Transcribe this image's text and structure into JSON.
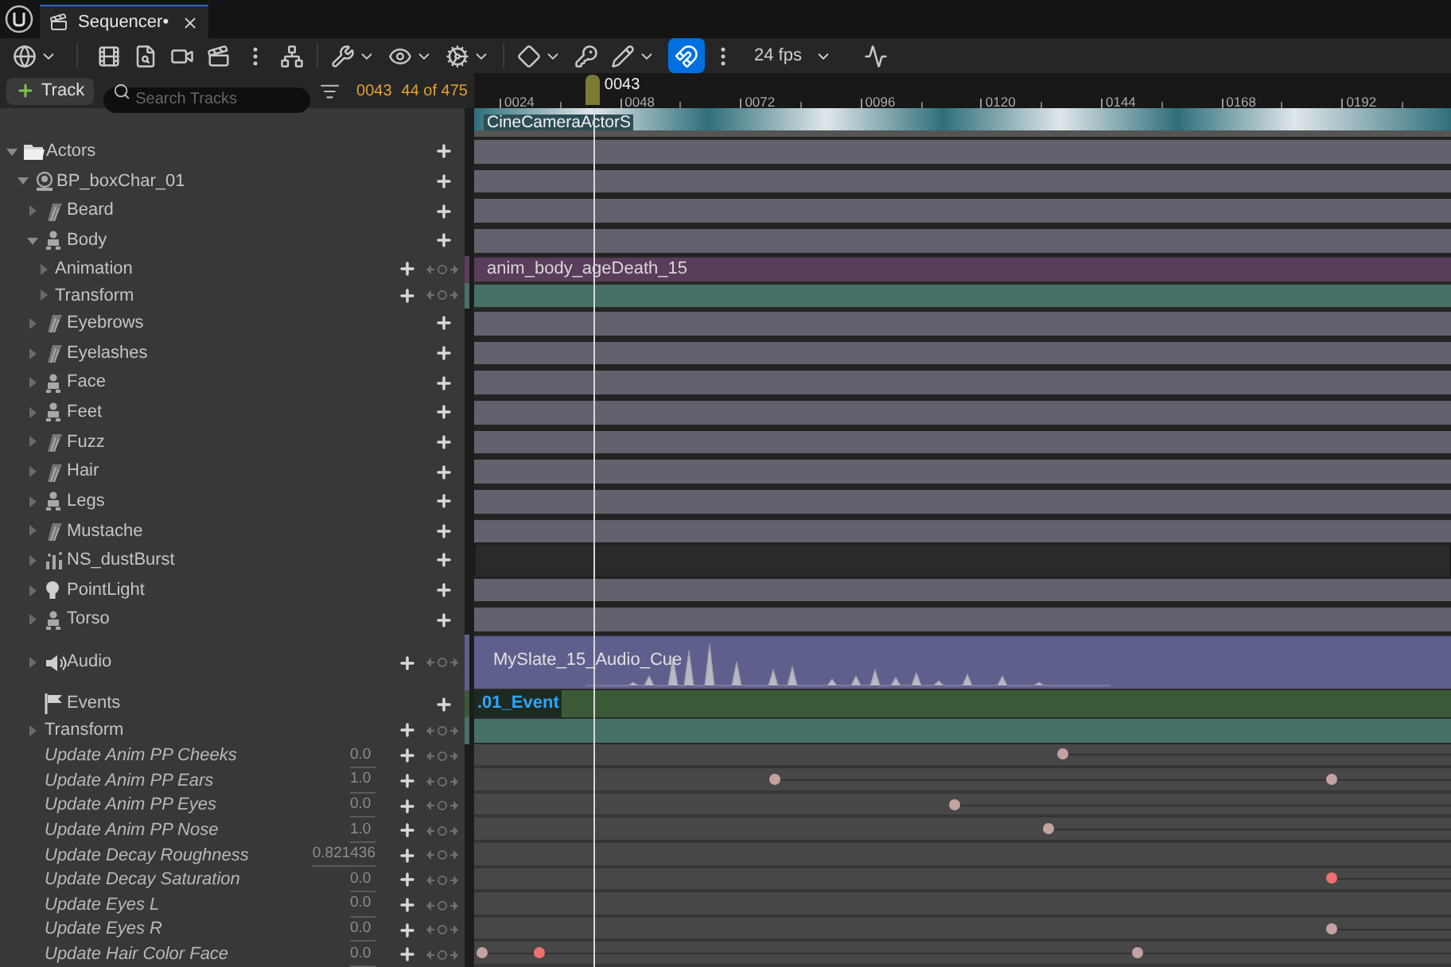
{
  "tab": {
    "title": "Sequencer•"
  },
  "toolbar": {
    "snap": {
      "selected": true
    },
    "frame_rate": "24 fps"
  },
  "header": {
    "add_track_button": "Track",
    "search": {
      "placeholder": "Search Tracks"
    },
    "current_frame": "0043",
    "track_count": "44 of 475"
  },
  "timeline": {
    "ticks": [
      "0024",
      "0048",
      "0072",
      "0096",
      "0120",
      "0144",
      "0168",
      "0192"
    ],
    "playhead": {
      "label": "0043",
      "level": 0.122
    }
  },
  "camera_track": {
    "label": "CineCameraActorS"
  },
  "tree": [
    {
      "label": "Actors",
      "kind": "folder",
      "expanded": true,
      "lane": {
        "kind": "bar"
      },
      "children": [
        {
          "label": "BP_boxChar_01",
          "kind": "blueprint",
          "expanded": true,
          "lane": {
            "kind": "bar"
          },
          "children": [
            {
              "label": "Beard",
              "kind": "groom",
              "expanded": false,
              "lane": {
                "kind": "bar"
              }
            },
            {
              "label": "Body",
              "kind": "mesh",
              "expanded": true,
              "lane": {
                "kind": "bar"
              },
              "children": [
                {
                  "label": "Animation",
                  "kind": "track",
                  "expanded": false,
                  "lane": {
                    "kind": "animation"
                  },
                  "section": "anim_body_ageDeath_15"
                },
                {
                  "label": "Transform",
                  "kind": "track",
                  "expanded": false,
                  "lane": {
                    "kind": "transform"
                  }
                }
              ]
            },
            {
              "label": "Eyebrows",
              "kind": "groom",
              "expanded": false,
              "lane": {
                "kind": "bar"
              }
            },
            {
              "label": "Eyelashes",
              "kind": "groom",
              "expanded": false,
              "lane": {
                "kind": "bar"
              }
            },
            {
              "label": "Face",
              "kind": "mesh",
              "expanded": false,
              "lane": {
                "kind": "bar"
              }
            },
            {
              "label": "Feet",
              "kind": "mesh",
              "expanded": false,
              "lane": {
                "kind": "bar"
              }
            },
            {
              "label": "Fuzz",
              "kind": "groom",
              "expanded": false,
              "lane": {
                "kind": "bar"
              }
            },
            {
              "label": "Hair",
              "kind": "groom",
              "expanded": false,
              "lane": {
                "kind": "bar"
              }
            },
            {
              "label": "Legs",
              "kind": "mesh",
              "expanded": false,
              "lane": {
                "kind": "bar"
              }
            },
            {
              "label": "Mustache",
              "kind": "groom",
              "expanded": false,
              "lane": {
                "kind": "bar"
              }
            },
            {
              "label": "NS_dustBurst",
              "kind": "niagara",
              "expanded": false,
              "lane": {
                "kind": "empty"
              }
            },
            {
              "label": "PointLight",
              "kind": "light",
              "expanded": false,
              "lane": {
                "kind": "bar"
              }
            },
            {
              "label": "Torso",
              "kind": "mesh",
              "expanded": false,
              "lane": {
                "kind": "bar"
              }
            },
            {
              "label": "Audio",
              "kind": "audio",
              "expanded": false,
              "lane": {
                "kind": "audio"
              },
              "section": "MySlate_15_Audio_Cue"
            },
            {
              "label": "Events",
              "kind": "events",
              "lane": {
                "kind": "event"
              },
              "section": ".01_Event",
              "selected": true
            },
            {
              "label": "Transform",
              "kind": "track",
              "expanded": false,
              "lane": {
                "kind": "transform"
              }
            },
            {
              "label": "Update Anim PP Cheeks",
              "kind": "property",
              "value": "0.0",
              "lane": {
                "kind": "keys"
              }
            },
            {
              "label": "Update Anim PP Ears",
              "kind": "property",
              "value": "1.0",
              "lane": {
                "kind": "keys"
              }
            },
            {
              "label": "Update Anim PP Eyes",
              "kind": "property",
              "value": "0.0",
              "lane": {
                "kind": "keys"
              }
            },
            {
              "label": "Update Anim PP Nose",
              "kind": "property",
              "value": "1.0",
              "lane": {
                "kind": "keys"
              }
            },
            {
              "label": "Update Decay Roughness",
              "kind": "property",
              "value": "0.821436",
              "lane": {
                "kind": "keys"
              }
            },
            {
              "label": "Update Decay Saturation",
              "kind": "property",
              "value": "0.0",
              "lane": {
                "kind": "keys"
              }
            },
            {
              "label": "Update Eyes L",
              "kind": "property",
              "value": "0.0",
              "lane": {
                "kind": "keys"
              }
            },
            {
              "label": "Update Eyes R",
              "kind": "property",
              "value": "0.0",
              "lane": {
                "kind": "keys"
              }
            },
            {
              "label": "Update Hair Color Face",
              "kind": "property",
              "value": "0.0",
              "lane": {
                "kind": "keys"
              }
            }
          ]
        }
      ]
    }
  ]
}
